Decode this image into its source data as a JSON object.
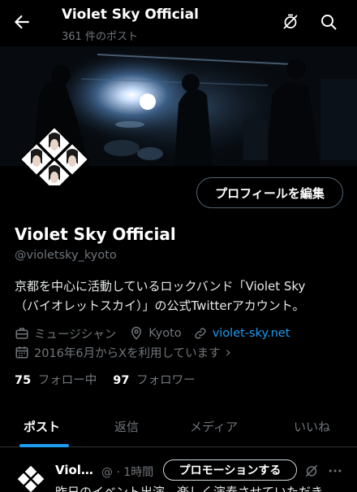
{
  "header": {
    "title": "Violet Sky Official",
    "subtitle": "361 件のポスト"
  },
  "icons": {
    "back": "arrow-left-icon",
    "no_notify": "bell-off-icon",
    "search": "search-icon",
    "category": "briefcase-icon",
    "location": "location-pin-icon",
    "link": "link-icon",
    "calendar": "calendar-icon",
    "more": "more-dots-icon"
  },
  "profile": {
    "edit_button": "プロフィールを編集",
    "name": "Violet Sky Official",
    "handle": "@violetsky_kyoto",
    "bio_line1": "京都を中心に活動しているロックバンド「Violet Sky",
    "bio_line2": "（バイオレットスカイ）」の公式Twitterアカウント。",
    "category": "ミュージシャン",
    "location": "Kyoto",
    "website": "violet-sky.net",
    "joined": "2016年6月からXを利用しています",
    "joined_chevron": "›",
    "following_count": "75",
    "following_label": "フォロー中",
    "followers_count": "97",
    "followers_label": "フォロワー"
  },
  "tabs": [
    {
      "label": "ポスト",
      "active": true
    },
    {
      "label": "返信",
      "active": false
    },
    {
      "label": "メディア",
      "active": false
    },
    {
      "label": "いいね",
      "active": false
    }
  ],
  "post": {
    "author": "Viol…",
    "time": "@ · 1時間",
    "promote_button": "プロモーションする",
    "text": "昨日のイベント出演、楽しく演奏させていただき"
  },
  "colors": {
    "background": "#000000",
    "accent": "#1d9bf0",
    "muted": "#71767b",
    "text": "#e7e9ea"
  }
}
